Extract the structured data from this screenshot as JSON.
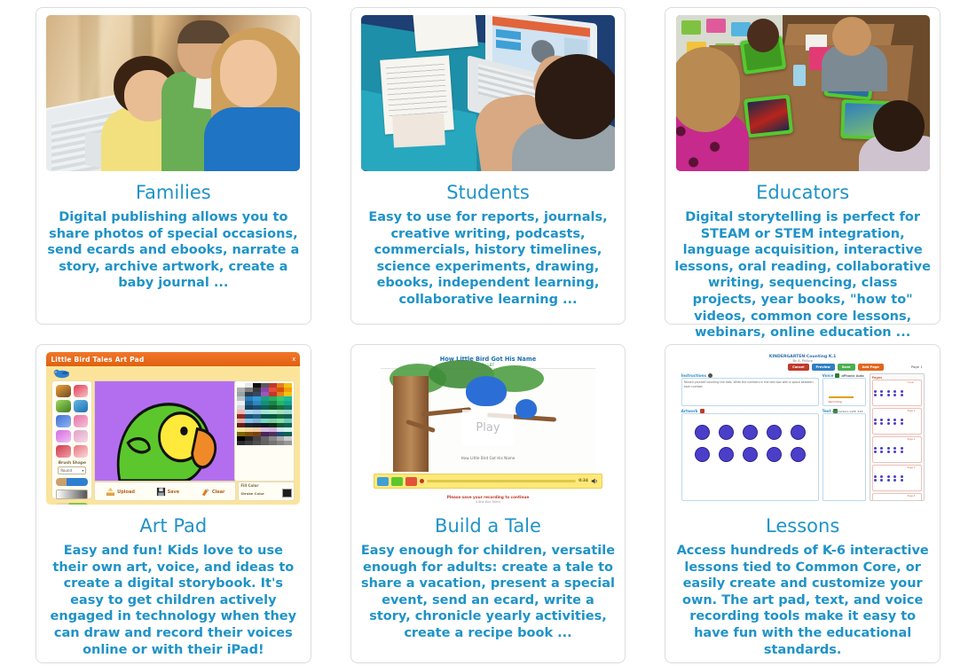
{
  "page": {
    "accent_color": "#1f93c8",
    "card_border_color": "#dcdcdc",
    "background": "#ffffff"
  },
  "cards": [
    {
      "id": "families",
      "title": "Families",
      "body": "Digital publishing allows you to share photos of special occasions, send ecards and ebooks, narrate a story, archive artwork, create a baby journal ...",
      "image_name": "family-at-laptop-photo"
    },
    {
      "id": "students",
      "title": "Students",
      "body": "Easy to use for reports, journals, creative writing, podcasts, commercials, history timelines, science experiments, drawing, ebooks, independent learning, collaborative learning ...",
      "image_name": "student-at-laptop-photo"
    },
    {
      "id": "educators",
      "title": "Educators",
      "body": "Digital storytelling is perfect for STEAM or STEM integration, language acquisition, interactive lessons, oral reading, collaborative writing, sequencing, class projects, year books, \"how to\" videos, common core lessons, webinars, online education ...",
      "image_name": "classroom-ipads-photo"
    },
    {
      "id": "art-pad",
      "title": "Art Pad",
      "body": "Easy and fun! Kids love to use their own art, voice, and ideas to create a digital storybook. It's easy to get children actively engaged in technology when they can draw and record their voices online or with their iPad!",
      "image_name": "art-pad-screenshot"
    },
    {
      "id": "build-a-tale",
      "title": "Build a Tale",
      "body": "Easy enough for children, versatile enough for adults: create a tale to share a vacation, present a special event, send an ecard, write a story, chronicle yearly activities, create a recipe book ...",
      "image_name": "build-a-tale-screenshot"
    },
    {
      "id": "lessons",
      "title": "Lessons",
      "body": "Access hundreds of K-6 interactive lessons tied to Common Core, or easily create and customize your own. The art pad, text, and voice recording tools make it easy to have fun with the educational standards.",
      "image_name": "lessons-screenshot"
    }
  ],
  "art_pad_screenshot": {
    "window_title": "Little Bird Tales Art Pad",
    "close_label": "x",
    "brush_shape_label": "Brush Shape",
    "brush_shape_value": "Round",
    "fill_color_label": "Fill Color",
    "stroke_color_label": "Stroke Color",
    "buttons": [
      {
        "label": "Upload",
        "icon": "upload-icon"
      },
      {
        "label": "Save",
        "icon": "floppy-disk-icon"
      },
      {
        "label": "Clear",
        "icon": "brush-icon"
      }
    ],
    "canvas_color": "#b36ef0",
    "titlebar_color": "#e8690f",
    "drawing": "green parrot with yellow face and orange beak"
  },
  "build_a_tale_screenshot": {
    "story_title": "How Little Bird Got His Name",
    "byline": "By LBT",
    "play_label": "Play",
    "caption": "How Little Bird Got His Name",
    "time": "0:34",
    "note": "Please save your recording to continue",
    "note_sub": "(Little Bird Tales)",
    "player_buttons": [
      "prev-page-button",
      "grid-view-button",
      "stop-button"
    ],
    "record_icon": "record-dot-icon",
    "volume_icon": "speaker-icon"
  },
  "lessons_screenshot": {
    "lesson_title": "KINDERGARTEN Counting K.1",
    "author": "By A. Philipp",
    "page_label": "Page 1",
    "buttons": [
      {
        "label": "Cancel",
        "color": "#c0392b"
      },
      {
        "label": "Preview",
        "color": "#2f7fc4"
      },
      {
        "label": "Save",
        "color": "#4caf50"
      },
      {
        "label": "Add Page",
        "color": "#e2661f"
      }
    ],
    "panels": [
      {
        "label": "Instructions",
        "icon": "help-icon"
      },
      {
        "label": "Voice",
        "icon": "record-icon",
        "meta": "dPhonic Auto"
      },
      {
        "label": "Artwork",
        "icon": "image-icon"
      },
      {
        "label": "Text",
        "icon": "text-icon",
        "meta": "Characters Left: 415"
      }
    ],
    "instructions_text": "Record yourself counting the dots. Write the numbers in the text box with a space between each number.",
    "pages_label": "Pages",
    "artwork_dots": 10,
    "dot_color": "#4b3fc9"
  }
}
